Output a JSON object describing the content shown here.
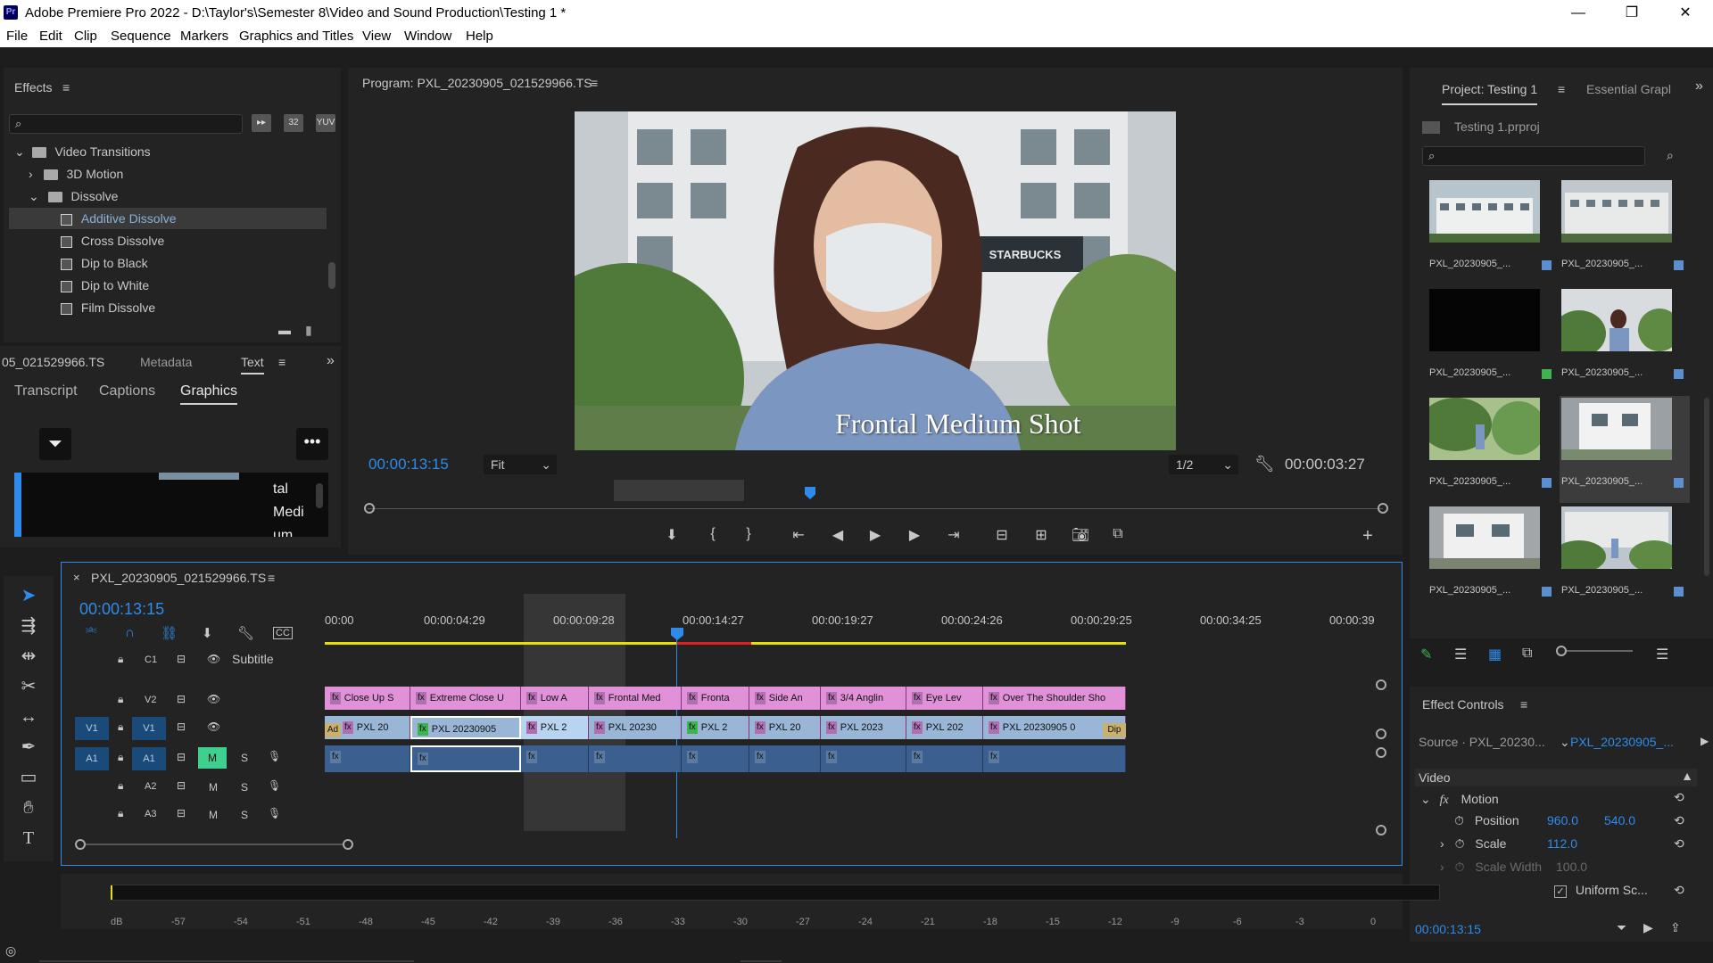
{
  "app": {
    "logo": "Pr",
    "title": "Adobe Premiere Pro 2022 - D:\\Taylor's\\Semester 8\\Video and Sound Production\\Testing 1 *",
    "window_buttons": [
      "—",
      "❐",
      "✕"
    ]
  },
  "menu": [
    "File",
    "Edit",
    "Clip",
    "Sequence",
    "Markers",
    "Graphics and Titles",
    "View",
    "Window",
    "Help"
  ],
  "effects_panel": {
    "title": "Effects",
    "tree": [
      {
        "label": "Video Transitions",
        "level": 0,
        "type": "folder"
      },
      {
        "label": "3D Motion",
        "level": 1,
        "type": "folder"
      },
      {
        "label": "Dissolve",
        "level": 1,
        "type": "folder"
      },
      {
        "label": "Additive Dissolve",
        "level": 2,
        "type": "effect",
        "selected": true
      },
      {
        "label": "Cross Dissolve",
        "level": 2,
        "type": "effect"
      },
      {
        "label": "Dip to Black",
        "level": 2,
        "type": "effect"
      },
      {
        "label": "Dip to White",
        "level": 2,
        "type": "effect"
      },
      {
        "label": "Film Dissolve",
        "level": 2,
        "type": "effect"
      }
    ]
  },
  "text_panel": {
    "tabs": [
      "05_021529966.TS",
      "Metadata",
      "Text"
    ],
    "subtabs": [
      "Transcript",
      "Captions",
      "Graphics"
    ],
    "preview_text": [
      "tal",
      "Medi",
      "um"
    ]
  },
  "program_monitor": {
    "title": "Program: PXL_20230905_021529966.TS",
    "overlay_text": "Frontal Medium Shot",
    "sign_text": "STARBUCKS",
    "timecode": "00:00:13:15",
    "fit": "Fit",
    "resolution": "1/2",
    "duration": "00:00:03:27"
  },
  "project_panel": {
    "tabs": [
      "Project: Testing 1",
      "Essential Grapl"
    ],
    "file": "Testing 1.prproj",
    "items": [
      {
        "label": "PXL_20230905_...",
        "badge": "#5b8fd0",
        "scene": "building"
      },
      {
        "label": "PXL_20230905_...",
        "badge": "#5b8fd0",
        "scene": "building2"
      },
      {
        "label": "PXL_20230905_...",
        "badge": "#3fb34f",
        "scene": "black"
      },
      {
        "label": "PXL_20230905_...",
        "badge": "#5b8fd0",
        "scene": "garden"
      },
      {
        "label": "PXL_20230905_...",
        "badge": "#5b8fd0",
        "scene": "green"
      },
      {
        "label": "PXL_20230905_...",
        "badge": "#5b8fd0",
        "scene": "white"
      },
      {
        "label": "PXL_20230905_...",
        "badge": "#5b8fd0",
        "scene": "white"
      },
      {
        "label": "PXL_20230905_...",
        "badge": "#5b8fd0",
        "scene": "plaza"
      }
    ]
  },
  "effect_controls": {
    "title": "Effect Controls",
    "source": "Source · PXL_20230...",
    "clip": "PXL_20230905_...",
    "section": "Video",
    "motion": "Motion",
    "position_label": "Position",
    "position_x": "960.0",
    "position_y": "540.0",
    "scale_label": "Scale",
    "scale": "112.0",
    "scale_width_label": "Scale Width",
    "scale_width": "100.0",
    "uniform": "Uniform Sc...",
    "timecode": "00:00:13:15"
  },
  "timeline": {
    "title": "PXL_20230905_021529966.TS",
    "timecode": "00:00:13:15",
    "ruler": [
      "00:00",
      "00:00:04:29",
      "00:00:09:28",
      "00:00:14:27",
      "00:00:19:27",
      "00:00:24:26",
      "00:00:29:25",
      "00:00:34:25",
      "00:00:39"
    ],
    "subtitle_label": "Subtitle",
    "tracks": {
      "c1": "C1",
      "v2": "V2",
      "v1_src": "V1",
      "v1": "V1",
      "a1_src": "A1",
      "a1": "A1",
      "a2": "A2",
      "a3": "A3",
      "m": "M",
      "s": "S"
    },
    "v2_clips": [
      {
        "label": "Close Up S"
      },
      {
        "label": "Extreme Close U"
      },
      {
        "label": "Low A"
      },
      {
        "label": "Frontal Med"
      },
      {
        "label": "Fronta"
      },
      {
        "label": "Side An"
      },
      {
        "label": "3/4 Anglin"
      },
      {
        "label": "Eye Lev"
      },
      {
        "label": "Over The Shoulder Sho"
      }
    ],
    "v1_clips": [
      {
        "label": "PXL 20"
      },
      {
        "label": "PXL 20230905"
      },
      {
        "label": "PXL 2"
      },
      {
        "label": "PXL 20230"
      },
      {
        "label": "PXL 2"
      },
      {
        "label": "PXL 20"
      },
      {
        "label": "PXL 2023"
      },
      {
        "label": "PXL 202"
      },
      {
        "label": "PXL 20230905 0"
      }
    ],
    "v1_start_tag": "Ad",
    "v1_end_tag": "Dip",
    "fx": "fx"
  },
  "meter": {
    "labels": [
      "dB",
      "-57",
      "-54",
      "-51",
      "-48",
      "-45",
      "-42",
      "-39",
      "-36",
      "-33",
      "-30",
      "-27",
      "-24",
      "-21",
      "-18",
      "-15",
      "-12",
      "-9",
      "-6",
      "-3",
      "0"
    ]
  },
  "colors": {
    "accent": "#2d8ceb",
    "clip_v2": "#e091d8",
    "clip_v1": "#9ab6d6",
    "clip_a1": "#3b5f8f",
    "work_area": "#e8e000",
    "render_red": "#e02020"
  }
}
